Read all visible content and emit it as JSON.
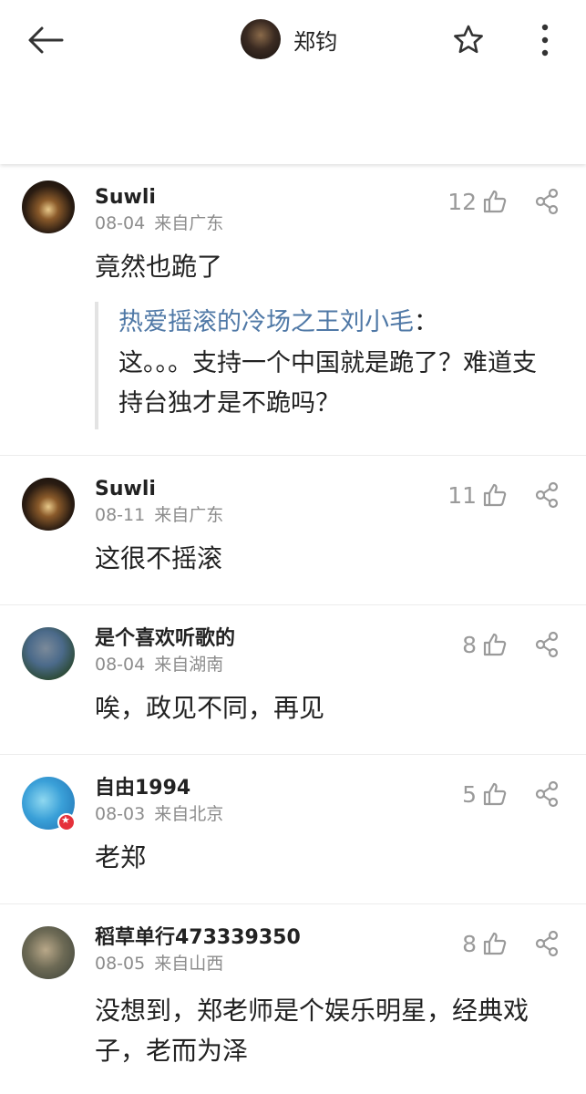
{
  "header": {
    "title": "郑钧",
    "icons": {
      "back": "back-arrow-icon",
      "favorite": "star-icon",
      "more": "more-vertical-icon"
    }
  },
  "comments": [
    {
      "username": "Suwli",
      "date": "08-04",
      "location": "来自广东",
      "likes": "12",
      "text": "竟然也跪了",
      "quote": {
        "author": "热爱摇滚的冷场之王刘小毛",
        "colon": "：",
        "text": "这。。。支持一个中国就是跪了？难道支持台独才是不跪吗？"
      }
    },
    {
      "username": "Suwli",
      "date": "08-11",
      "location": "来自广东",
      "likes": "11",
      "text": "这很不摇滚"
    },
    {
      "username": "是个喜欢听歌的",
      "date": "08-04",
      "location": "来自湖南",
      "likes": "8",
      "text": "唉，政见不同，再见"
    },
    {
      "username": "自由1994",
      "date": "08-03",
      "location": "来自北京",
      "likes": "5",
      "text": "老郑"
    },
    {
      "username": "稻草单行473339350",
      "date": "08-05",
      "location": "来自山西",
      "likes": "8",
      "text": "没想到，郑老师是个娱乐明星，经典戏子，老而为泽"
    }
  ],
  "colors": {
    "quote_author": "#4f78a6",
    "meta": "#8c8c8c",
    "badge": "#e5303a"
  }
}
